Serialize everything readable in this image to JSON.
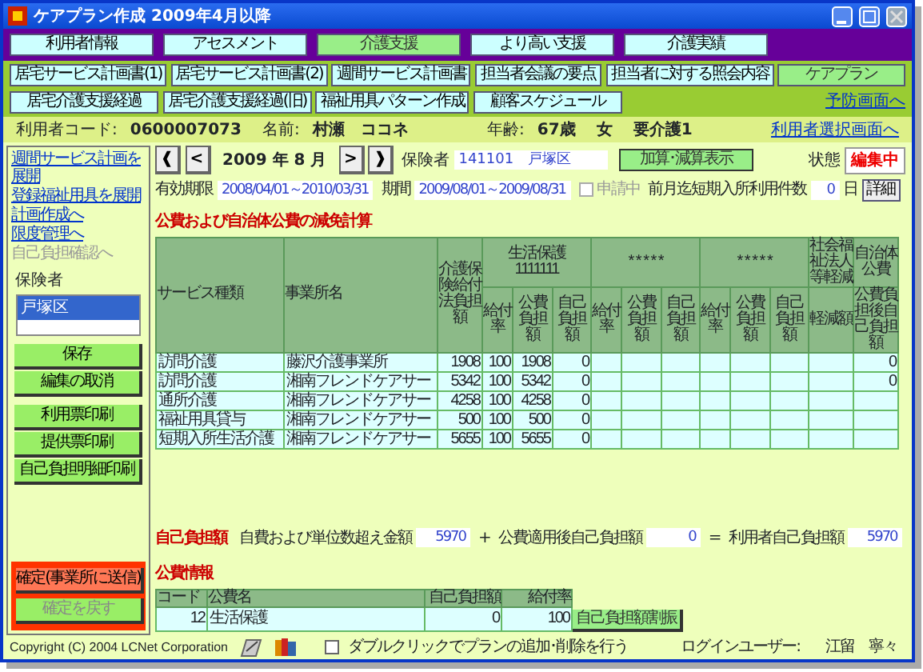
{
  "window": {
    "title": "ケアプラン作成 2009年4月以降"
  },
  "main_tabs": [
    {
      "label": "利用者情報",
      "selected": false
    },
    {
      "label": "アセスメント",
      "selected": false
    },
    {
      "label": "介護支援",
      "selected": true
    },
    {
      "label": "より高い支援",
      "selected": false
    },
    {
      "label": "介護実績",
      "selected": false
    }
  ],
  "sub_tab_rows": [
    [
      {
        "label": "居宅サービス計画書(1)",
        "selected": false
      },
      {
        "label": "居宅サービス計画書(2)",
        "selected": false
      },
      {
        "label": "週間サービス計画書",
        "selected": false
      },
      {
        "label": "担当者会議の要点",
        "selected": false
      },
      {
        "label": "担当者に対する照会内容",
        "selected": false
      },
      {
        "label": "ケアプラン",
        "selected": true
      }
    ],
    [
      {
        "label": "居宅介護支援経過",
        "selected": false
      },
      {
        "label": "居宅介護支援経過(旧)",
        "selected": false
      },
      {
        "label": "福祉用具パターン作成",
        "selected": false
      },
      {
        "label": "顧客スケジュール",
        "selected": false
      }
    ]
  ],
  "preventive_link": "予防画面へ",
  "user_bar": {
    "code_label": "利用者コード:",
    "code": "0600007073",
    "name_label": "名前:",
    "name": "村瀬　ココネ",
    "age_label": "年齢:",
    "age": "67歳",
    "sex": "女",
    "care_level": "要介護1",
    "select_link": "利用者選択画面へ"
  },
  "sidebar": {
    "links": [
      {
        "label": "週間サービス計画を展開",
        "disabled": false
      },
      {
        "label": "登録福祉用具を展開",
        "disabled": false
      },
      {
        "label": "計画作成へ",
        "disabled": false
      },
      {
        "label": "限度管理へ",
        "disabled": false
      },
      {
        "label": "自己負担確認へ",
        "disabled": true
      }
    ],
    "insurer_label": "保険者",
    "insurers": [
      {
        "label": "戸塚区",
        "selected": true
      }
    ],
    "buttons": [
      {
        "label": "保存"
      },
      {
        "label": "編集の取消"
      },
      {
        "label": "利用票印刷"
      },
      {
        "label": "提供票印刷"
      },
      {
        "label": "自己負担明細印刷"
      }
    ],
    "confirm_buttons": [
      {
        "label": "確定(事業所に送信)",
        "disabled": false
      },
      {
        "label": "確定を戻す",
        "disabled": true
      }
    ]
  },
  "period_nav": {
    "prev_year": "❰",
    "prev": "<",
    "month": "2009 年 8 月",
    "next": ">",
    "next_year": "❱"
  },
  "insurer": {
    "label": "保険者",
    "value": "141101　戸塚区"
  },
  "adjust_button": "加算･減算表示",
  "status": {
    "label": "状態",
    "value": "編集中"
  },
  "validity": {
    "label": "有効期限",
    "value": "2008/04/01～2010/03/31"
  },
  "period": {
    "label": "期間",
    "value": "2009/08/01～2009/08/31"
  },
  "applying": {
    "label": "申請中",
    "checked": false,
    "disabled": true
  },
  "short_stay": {
    "label": "前月迄短期入所利用件数",
    "value": "0",
    "unit": "日"
  },
  "detail_button": "詳細",
  "calc": {
    "title": "公費および自治体公費の減免計算",
    "header_rows": [
      [
        {
          "label": "サービス種類",
          "rowspan": 2
        },
        {
          "label": "事業所名",
          "rowspan": 2
        },
        {
          "label": "介護保険給付法負担額",
          "rowspan": 2
        },
        {
          "label": "生活保護",
          "code": "1111111",
          "colspan": 3
        },
        {
          "label": "* * * * *",
          "colspan": 3
        },
        {
          "label": "* * * * *",
          "colspan": 3
        },
        {
          "label": "社会福祉法人等軽減"
        },
        {
          "label": "自治体公費"
        }
      ],
      [
        {
          "label": "給付率"
        },
        {
          "label": "公費負担額"
        },
        {
          "label": "自己負担額"
        },
        {
          "label": "給付率"
        },
        {
          "label": "公費負担額"
        },
        {
          "label": "自己負担額"
        },
        {
          "label": "給付率"
        },
        {
          "label": "公費負担額"
        },
        {
          "label": "自己負担額"
        },
        {
          "label": "軽減額"
        },
        {
          "label": "公費負担後自己負担額"
        }
      ]
    ],
    "rows": [
      {
        "cells": [
          "訪問介護",
          "藤沢介護事業所",
          "1908",
          "100",
          "1908",
          "0"
        ],
        "municipal": "0"
      },
      {
        "cells": [
          "訪問介護",
          "湘南フレンドケアサー",
          "5342",
          "100",
          "5342",
          "0"
        ],
        "municipal": "0"
      },
      {
        "cells": [
          "通所介護",
          "湘南フレンドケアサー",
          "4258",
          "100",
          "4258",
          "0"
        ]
      },
      {
        "cells": [
          "福祉用具貸与",
          "湘南フレンドケアサー",
          "500",
          "100",
          "500",
          "0"
        ]
      },
      {
        "cells": [
          "短期入所生活介護",
          "湘南フレンドケアサー",
          "5655",
          "100",
          "5655",
          "0"
        ]
      }
    ]
  },
  "self_pay": {
    "title": "自己負担額",
    "items": [
      {
        "label": "自費および単位数超え金額",
        "value": "5970"
      },
      {
        "label": "公費適用後自己負担額",
        "value": "0"
      },
      {
        "label": "利用者自己負担額",
        "value": "5970"
      }
    ],
    "operators": [
      "+",
      "="
    ]
  },
  "public_funds": {
    "title": "公費情報",
    "columns": [
      "コード",
      "公費名",
      "自己負担額",
      "給付率"
    ],
    "rows": [
      [
        "12",
        "生活保護",
        "0",
        "100"
      ]
    ],
    "button": "自己負担額割振"
  },
  "footer": {
    "copyright": "Copyright (C) 2004 LCNet Corporation",
    "dblclick": {
      "label": "ダブルクリックでプランの追加･削除を行う",
      "checked": false
    },
    "login_label": "ログインユーザー:",
    "login_user": "江留　寧々"
  }
}
